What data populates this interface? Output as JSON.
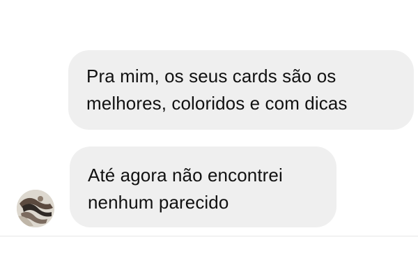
{
  "conversation": {
    "messages": [
      {
        "sender": "me",
        "lines": [
          "Pra mim, os seus cards são os",
          "melhores, coloridos e com dicas"
        ]
      },
      {
        "sender": "other",
        "lines": [
          "Até agora não encontrei",
          "nenhum parecido"
        ],
        "avatar_icon": "user-avatar-icon"
      }
    ]
  },
  "colors": {
    "page_background": "#ffffff",
    "bubble_background": "#efefef",
    "bubble_text": "#111111",
    "divider": "#e6e6e6"
  }
}
